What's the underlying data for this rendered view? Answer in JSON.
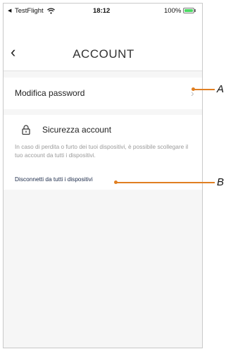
{
  "status_bar": {
    "carrier": "TestFlight",
    "time": "18:12",
    "battery_percent": "100%",
    "battery_level": 1.0
  },
  "nav": {
    "title": "ACCOUNT"
  },
  "menu": {
    "change_password_label": "Modifica password"
  },
  "security": {
    "title": "Sicurezza account",
    "description": "In caso di perdita o furto dei tuoi dispositivi, è possibile scollegare il tuo account da tutti i dispositivi.",
    "disconnect_label": "Disconnetti da tutti i dispositivi"
  },
  "callouts": {
    "a": "A",
    "b": "B"
  },
  "colors": {
    "callout": "#e07f22",
    "link": "#1c2b4a",
    "battery": "#4cd964"
  }
}
